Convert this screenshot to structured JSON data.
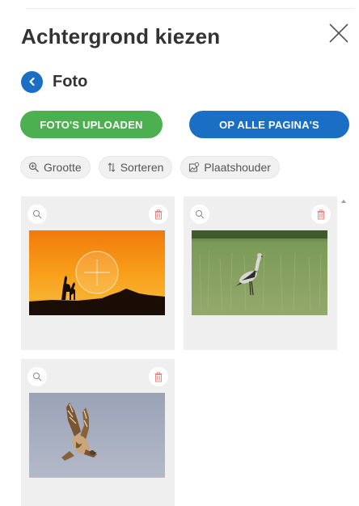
{
  "header": {
    "title": "Achtergrond kiezen",
    "close_icon": "close-icon"
  },
  "nav": {
    "back_icon": "chevron-left-icon",
    "section_label": "Foto"
  },
  "actions": {
    "upload_label": "FOTO'S UPLOADEN",
    "apply_all_label": "OP ALLE PAGINA'S"
  },
  "filters": [
    {
      "label": "Grootte",
      "icon": "zoom-icon"
    },
    {
      "label": "Sorteren",
      "icon": "sort-icon"
    },
    {
      "label": "Plaatshouder",
      "icon": "placeholder-image-icon"
    }
  ],
  "gallery": {
    "items": [
      {
        "subject": "giraffes at sunset",
        "selected": true
      },
      {
        "subject": "secretary bird in grass",
        "selected": false
      },
      {
        "subject": "buzzard in flight",
        "selected": false
      }
    ]
  },
  "colors": {
    "primary_blue": "#1a6fc4",
    "upload_green": "#4caf50",
    "delete_red": "#e88a8a",
    "tile_bg": "#efefef"
  }
}
